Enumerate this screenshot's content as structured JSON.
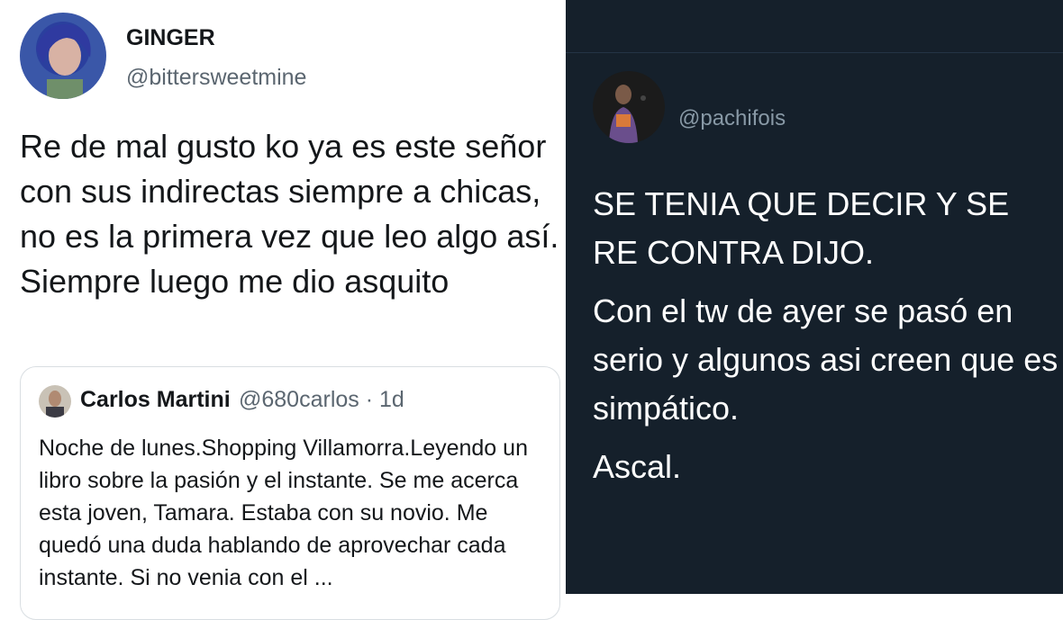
{
  "left_tweet": {
    "name": "GINGER",
    "handle": "@bittersweetmine",
    "text": "Re de mal gusto ko ya es este señor con sus indirectas siempre a chicas, no es la primera vez que leo algo así. Siempre luego me dio asquito",
    "quoted": {
      "name": "Carlos Martini",
      "handle_time": "@680carlos · 1d",
      "text": "Noche de lunes.Shopping Villamorra.Leyendo un  libro sobre la pasión y el instante. Se me acerca esta joven, Tamara. Estaba con su novio. Me quedó una duda hablando de aprovechar cada instante. Si no venia con el ..."
    }
  },
  "right_tweet": {
    "handle": "@pachifois",
    "paragraphs": [
      "SE TENIA QUE DECIR Y SE RE CONTRA DIJO.",
      "Con el tw de ayer se pasó en serio y algunos asi creen que es simpático.",
      "Ascal."
    ]
  },
  "colors": {
    "light_bg": "#ffffff",
    "dark_bg": "#15202b",
    "muted_light": "#5b6670",
    "muted_dark": "#8899a6"
  }
}
